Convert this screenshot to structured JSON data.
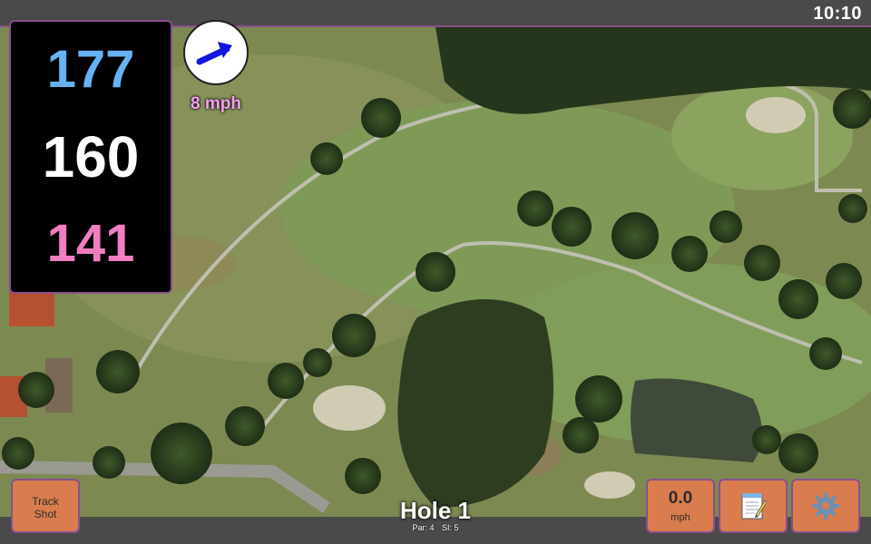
{
  "clock": "10:10",
  "distances": {
    "back": "177",
    "middle": "160",
    "front": "141"
  },
  "wind": {
    "speed_label": "8 mph",
    "direction_icon": "arrow-up-right-icon"
  },
  "buttons": {
    "track_shot_line1": "Track",
    "track_shot_line2": "Shot",
    "speed_value": "0.0",
    "speed_unit": "mph",
    "notes_icon": "notepad-icon",
    "settings_icon": "gear-icon"
  },
  "hole": {
    "title": "Hole 1",
    "par": "Par: 4",
    "si": "SI: 5"
  },
  "colors": {
    "back_distance": "#66b2f2",
    "middle_distance": "#ffffff",
    "front_distance": "#f07ec0",
    "button_bg": "#d97d4e",
    "accent_border": "#8a4f8d",
    "wind_label": "#f5a0f0"
  }
}
